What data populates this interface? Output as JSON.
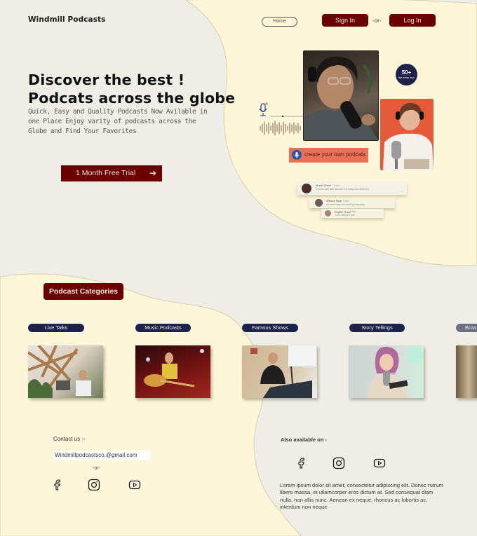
{
  "header": {
    "logo": "Windmill Podcasts",
    "nav": {
      "home": "Home",
      "sign_in": "Sign In",
      "separator": "-or-",
      "log_in": "Log In"
    }
  },
  "hero": {
    "title_line1": "Discover the best !",
    "title_line2": "Podcats across the globe",
    "subtitle": "Quick, Easy and Quality Podcasts Now Avilable in one Place Enjoy varity of podcasts across the Globe and Find Your Favorites",
    "cta_label": "1 Month Free Trial",
    "cta_icon": "arrow-right-icon",
    "badge_number": "50+",
    "badge_sub": "live every hour",
    "create_label": "create your own podcats",
    "comments": [
      {
        "name": "Muriel Greer",
        "time": "1 sec",
        "text": "Just in Love with this one it is really too much fun"
      },
      {
        "name": "William Neal",
        "time": "2 sec",
        "text": "He back from and coming everyday"
      },
      {
        "name": "Sophie Rose",
        "time": "3 sec",
        "text": "Love natural it one"
      }
    ]
  },
  "categories": {
    "title": "Podcast Categories",
    "items": [
      {
        "label": "Live Talks"
      },
      {
        "label": "Music Podcasts"
      },
      {
        "label": "Famous Shows"
      },
      {
        "label": "Story Tellings"
      },
      {
        "label": "Broa"
      }
    ]
  },
  "footer": {
    "contact_label": "Contact us --",
    "email": "Windmillpodcastsco.@gmail.com",
    "or": "-or-",
    "also_label": "Also available on -",
    "social_icons": [
      "facebook-icon",
      "instagram-icon",
      "youtube-icon"
    ],
    "lorem": "Lorem ipsum dolor sit amet, consectetur adipiscing elit. Donec rutrum libero massa, et ullamcorper eros dictum at. Sed consequat diam nulla, non allis nunc. Aenean ex neque, rhoncus ac lobortis ac, interdum non neque"
  },
  "colors": {
    "brand": "#6b0000",
    "navy": "#1d2348",
    "cream": "#fdf6d8",
    "background": "#efeee6",
    "accent": "#ee6e55"
  }
}
